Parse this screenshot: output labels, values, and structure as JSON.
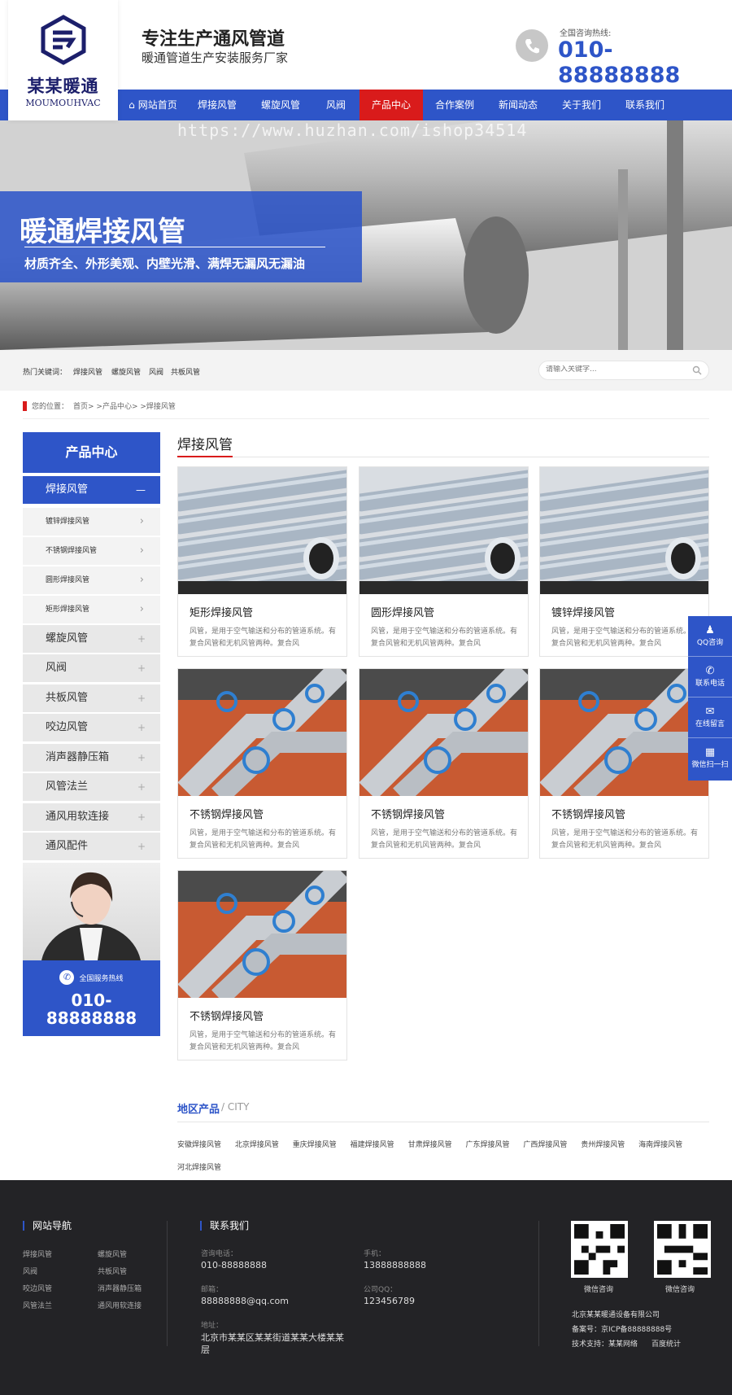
{
  "logo": {
    "name": "某某暖通",
    "en": "MOUMOUHVAC"
  },
  "header": {
    "slogan_main": "专注生产通风管道",
    "slogan_sub": "暖通管道生产安装服务厂家",
    "hotline_label": "全国咨询热线:",
    "hotline_number": "010-88888888"
  },
  "nav": {
    "items": [
      {
        "label": "网站首页"
      },
      {
        "label": "焊接风管"
      },
      {
        "label": "螺旋风管"
      },
      {
        "label": "风阀"
      },
      {
        "label": "产品中心"
      },
      {
        "label": "合作案例"
      },
      {
        "label": "新闻动态"
      },
      {
        "label": "关于我们"
      },
      {
        "label": "联系我们"
      }
    ],
    "active_index": 4
  },
  "banner": {
    "title": "暖通焊接风管",
    "subtitle": "材质齐全、外形美观、内壁光滑、满焊无漏风无漏油",
    "watermark": "https://www.huzhan.com/ishop34514"
  },
  "hotbar": {
    "label": "热门关键词：",
    "keywords": [
      "焊接风管",
      "螺旋风管",
      "风阀",
      "共板风管"
    ],
    "search_placeholder": "请输入关键字..."
  },
  "breadcrumb": {
    "label": "您的位置：",
    "path": "首页> >产品中心> >焊接风管"
  },
  "sidebar": {
    "title": "产品中心",
    "active": {
      "label": "焊接风管",
      "toggle": "—"
    },
    "subitems": [
      "镀锌焊接风管",
      "不锈钢焊接风管",
      "圆形焊接风管",
      "矩形焊接风管"
    ],
    "items": [
      "螺旋风管",
      "风阀",
      "共板风管",
      "咬边风管",
      "消声器静压箱",
      "风管法兰",
      "通风用软连接",
      "通风配件"
    ],
    "plus": "+",
    "arrow": "›",
    "service_label": "全国服务热线",
    "service_number_1": "010-",
    "service_number_2": "88888888"
  },
  "section": {
    "title": "焊接风管"
  },
  "products": [
    {
      "title": "矩形焊接风管",
      "desc": "风管，是用于空气输送和分布的管道系统。有复合风管和无机风管两种。复合风",
      "image": "blue-pipes"
    },
    {
      "title": "圆形焊接风管",
      "desc": "风管，是用于空气输送和分布的管道系统。有复合风管和无机风管两种。复合风",
      "image": "blue-pipes"
    },
    {
      "title": "镀锌焊接风管",
      "desc": "风管，是用于空气输送和分布的管道系统。有复合风管和无机风管两种。复合风",
      "image": "blue-pipes"
    },
    {
      "title": "不锈钢焊接风管",
      "desc": "风管，是用于空气输送和分布的管道系统。有复合风管和无机风管两种。复合风",
      "image": "valves"
    },
    {
      "title": "不锈钢焊接风管",
      "desc": "风管，是用于空气输送和分布的管道系统。有复合风管和无机风管两种。复合风",
      "image": "valves"
    },
    {
      "title": "不锈钢焊接风管",
      "desc": "风管，是用于空气输送和分布的管道系统。有复合风管和无机风管两种。复合风",
      "image": "valves"
    },
    {
      "title": "不锈钢焊接风管",
      "desc": "风管，是用于空气输送和分布的管道系统。有复合风管和无机风管两种。复合风",
      "image": "valves"
    }
  ],
  "region": {
    "title": "地区产品",
    "city": "/ CITY",
    "links": [
      "安徽焊接风管",
      "北京焊接风管",
      "重庆焊接风管",
      "福建焊接风管",
      "甘肃焊接风管",
      "广东焊接风管",
      "广西焊接风管",
      "贵州焊接风管",
      "海南焊接风管",
      "河北焊接风管"
    ]
  },
  "footer": {
    "nav_title": "网站导航",
    "nav_links": [
      "焊接风管",
      "螺旋风管",
      "风阀",
      "共板风管",
      "咬边风管",
      "消声器静压箱",
      "风管法兰",
      "通风用软连接"
    ],
    "contact_title": "联系我们",
    "phone_label": "咨询电话：",
    "phone": "010-88888888",
    "mobile_label": "手机：",
    "mobile": "13888888888",
    "email_label": "邮箱：",
    "email": "88888888@qq.com",
    "qq_label": "公司QQ：",
    "qq": "123456789",
    "addr_label": "地址：",
    "addr": "北京市某某区某某街道某某大楼某某层",
    "qr1_label": "微信咨询",
    "qr2_label": "微信咨询",
    "company": "北京某某暖通设备有限公司",
    "icp": "备案号：京ICP备88888888号",
    "support": "技术支持：某某网络",
    "stats": "百度统计"
  },
  "float_bar": {
    "items": [
      "QQ咨询",
      "联系电话",
      "在线留言",
      "微信扫一扫"
    ]
  },
  "colors": {
    "brand_blue": "#2e55c8",
    "accent_red": "#d91b1b",
    "footer_bg": "#232326"
  }
}
